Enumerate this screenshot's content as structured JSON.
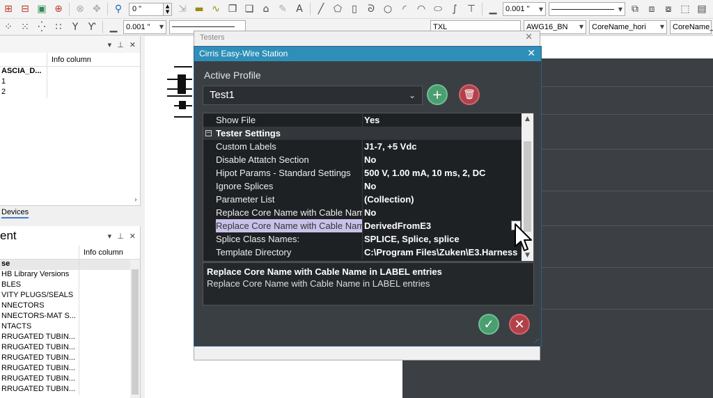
{
  "toolbar1": {
    "line_width_value": "0 \"",
    "line_width2_value": "0.001 \""
  },
  "toolbar2": {
    "width_value": "0.001 \"",
    "text_style": "TXL",
    "wire_type": "AWG16_BN",
    "core_name_h": "CoreName_hori",
    "core_name_v": "CoreName_v"
  },
  "left_panel_top": {
    "header": "Info column",
    "rows": [
      {
        "c1": "ASCIA_D...",
        "c2": ""
      },
      {
        "c1": "1",
        "c2": ""
      },
      {
        "c1": "2",
        "c2": ""
      }
    ],
    "tab": "Devices"
  },
  "left_panel_bottom": {
    "title": "ent",
    "header": "Info column",
    "rows": [
      "se",
      "HB Library Versions",
      "BLES",
      "VITY PLUGS/SEALS",
      "NNECTORS",
      "NNECTORS-MAT S...",
      "NTACTS",
      "RRUGATED TUBIN...",
      "RRUGATED TUBIN...",
      "RRUGATED TUBIN...",
      "RRUGATED TUBIN...",
      "RRUGATED TUBIN...",
      "RRUGATED TUBIN..."
    ]
  },
  "testers_dialog": {
    "title": "Testers"
  },
  "dialog": {
    "title": "Cirris Easy-Wire Station",
    "active_profile_label": "Active Profile",
    "profile_value": "Test1",
    "properties": [
      {
        "key": "Show File",
        "value": "Yes",
        "type": "row"
      },
      {
        "key": "Tester Settings",
        "value": "",
        "type": "category"
      },
      {
        "key": "Custom Labels",
        "value": "J1-7, +5 Vdc",
        "type": "row"
      },
      {
        "key": "Disable Attatch Section",
        "value": "No",
        "type": "row"
      },
      {
        "key": "Hipot Params - Standard Settings",
        "value": "500 V,  1.00 mA,  10 ms,  2,  DC",
        "type": "row"
      },
      {
        "key": "Ignore Splices",
        "value": "No",
        "type": "row"
      },
      {
        "key": "Parameter List",
        "value": "(Collection)",
        "type": "row"
      },
      {
        "key": "Replace Core Name with Cable Name",
        "value": "No",
        "type": "row"
      },
      {
        "key": "Replace Core Name with Cable Name",
        "value": "DerivedFromE3",
        "type": "selected"
      },
      {
        "key": "Splice Class Names:",
        "value": "SPLICE, Splice, splice",
        "type": "row"
      },
      {
        "key": "Template Directory",
        "value": "C:\\Program Files\\Zuken\\E3.Harness",
        "type": "row"
      }
    ],
    "description_title": "Replace Core Name with Cable Name in LABEL entries",
    "description_text": "Replace Core Name with Cable Name in LABEL entries"
  },
  "colors": {
    "dialog_bg": "#3a3f44",
    "titlebar": "#2e8fb8",
    "ok_green": "#4a9e70",
    "cancel_red": "#b24149",
    "selection": "#c8c2ea"
  }
}
